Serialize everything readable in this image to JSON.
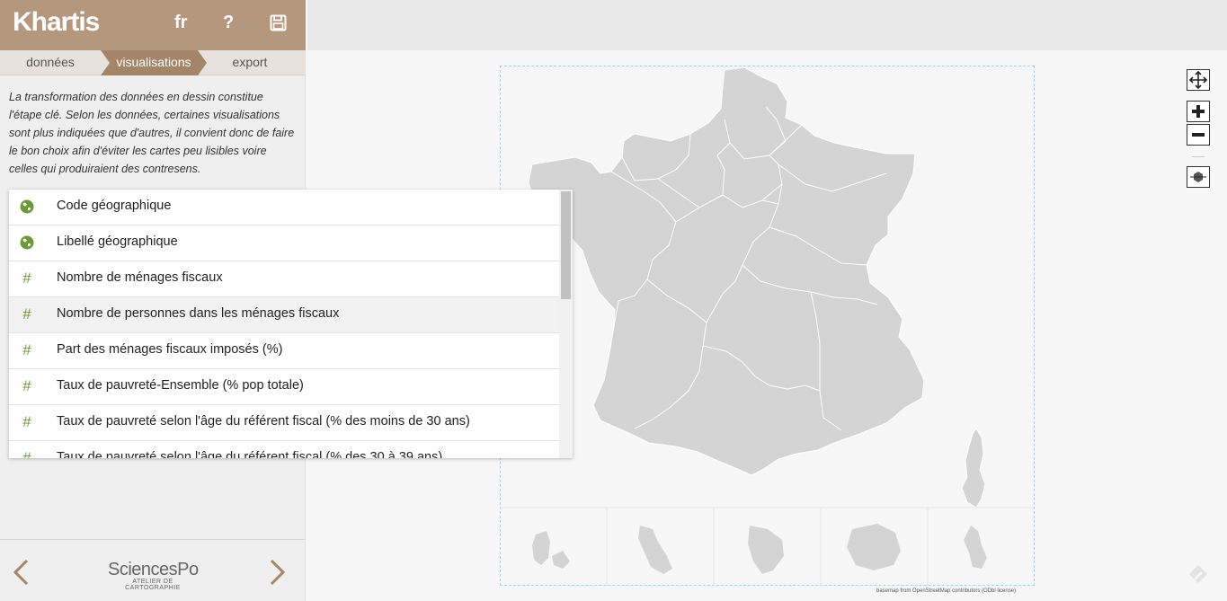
{
  "app": {
    "title": "Khartis"
  },
  "header": {
    "lang_label": "fr",
    "help_label": "?",
    "save_icon": "save-icon"
  },
  "steps": [
    {
      "label": "données"
    },
    {
      "label": "visualisations"
    },
    {
      "label": "export"
    }
  ],
  "description": "La transformation des données en dessin constitue l'étape clé. Selon les données, certaines visualisations sont plus indiquées que d'autres, il convient donc de faire le bon choix afin d'éviter les cartes peu lisibles voire celles qui produiraient des contresens.",
  "variables": [
    {
      "icon": "globe-icon",
      "label": "Code géographique"
    },
    {
      "icon": "globe-icon",
      "label": "Libellé géographique"
    },
    {
      "icon": "hash-icon",
      "label": "Nombre de ménages fiscaux"
    },
    {
      "icon": "hash-icon",
      "label": "Nombre de personnes dans les ménages fiscaux"
    },
    {
      "icon": "hash-icon",
      "label": "Part des ménages fiscaux imposés (%)"
    },
    {
      "icon": "hash-icon",
      "label": "Taux de pauvreté-Ensemble (% pop totale)"
    },
    {
      "icon": "hash-icon",
      "label": "Taux de pauvreté selon l'âge du référent fiscal (% des moins de 30 ans)"
    },
    {
      "icon": "hash-icon",
      "label": "Taux de pauvreté selon l'âge du référent fiscal (% des 30 à 39 ans)"
    }
  ],
  "footer": {
    "logo_name": "SciencesPo",
    "logo_sub": "ATELIER DE CARTOGRAPHIE"
  },
  "map": {
    "attribution": "basemap from OpenStreetMap contributors (ODbl license)"
  },
  "colors": {
    "header_bg": "#b4977c",
    "accent": "#a58568",
    "map_fill": "#d4d4d4",
    "icon_green": "#6a9a3a"
  }
}
